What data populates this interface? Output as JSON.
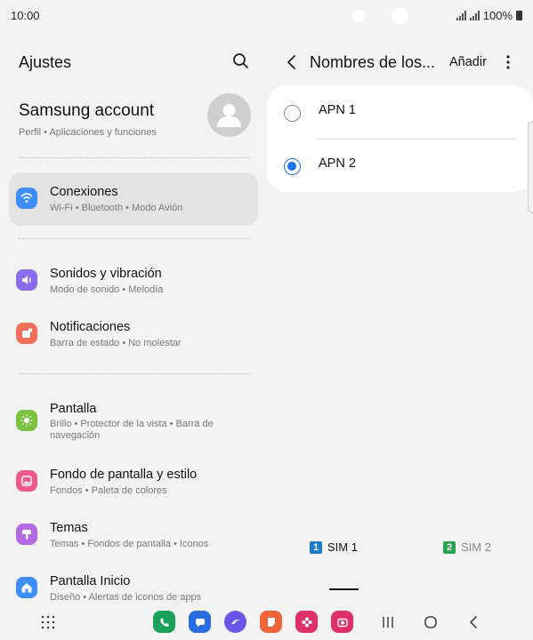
{
  "status": {
    "time": "10:00",
    "battery": "100%"
  },
  "left": {
    "title": "Ajustes",
    "account": {
      "name": "Samsung account",
      "subtitle": "Perfil  •  Aplicaciones y funciones"
    },
    "items": [
      {
        "label": "Conexiones",
        "sub": "Wi-Fi  •  Bluetooth  •  Modo Avión",
        "icon": "wifi-icon",
        "color": "#3d8ef8"
      },
      {
        "label": "Sonidos y vibración",
        "sub": "Modo de sonido  •  Melodía",
        "icon": "speaker-icon",
        "color": "#8b6cf0"
      },
      {
        "label": "Notificaciones",
        "sub": "Barra de estado  •  No molestar",
        "icon": "notification-icon",
        "color": "#f36f5a"
      },
      {
        "label": "Pantalla",
        "sub": "Brillo  •  Protector de la vista  •  Barra de navegación",
        "icon": "sun-icon",
        "color": "#7bc242"
      },
      {
        "label": "Fondo de pantalla y estilo",
        "sub": "Fondos  •  Paleta de colores",
        "icon": "image-icon",
        "color": "#ef5a8a"
      },
      {
        "label": "Temas",
        "sub": "Temas  •  Fondos de pantalla  •  Iconos",
        "icon": "brush-icon",
        "color": "#b26be0"
      },
      {
        "label": "Pantalla Inicio",
        "sub": "Diseño  •  Alertas de iconos de apps",
        "icon": "home-icon",
        "color": "#3d8ef8"
      }
    ]
  },
  "right": {
    "title": "Nombres de los...",
    "add_label": "Añadir",
    "apns": [
      {
        "label": "APN 1",
        "selected": false
      },
      {
        "label": "APN 2",
        "selected": true
      }
    ],
    "sim_tabs": [
      {
        "badge": "1",
        "label": "SIM 1",
        "active": true,
        "color": "#1e7bc6"
      },
      {
        "badge": "2",
        "label": "SIM 2",
        "active": false,
        "color": "#2aa050"
      }
    ]
  },
  "dock": {
    "apps": [
      {
        "name": "phone-app-icon",
        "color": "#1aa25b"
      },
      {
        "name": "messages-app-icon",
        "color": "#2a6de0"
      },
      {
        "name": "internet-app-icon",
        "color": "#6a55e8"
      },
      {
        "name": "notes-app-icon",
        "color": "#f0643a"
      },
      {
        "name": "gallery-app-icon",
        "color": "#e0306a"
      },
      {
        "name": "camera-app-icon",
        "color": "#e0306a"
      }
    ]
  }
}
